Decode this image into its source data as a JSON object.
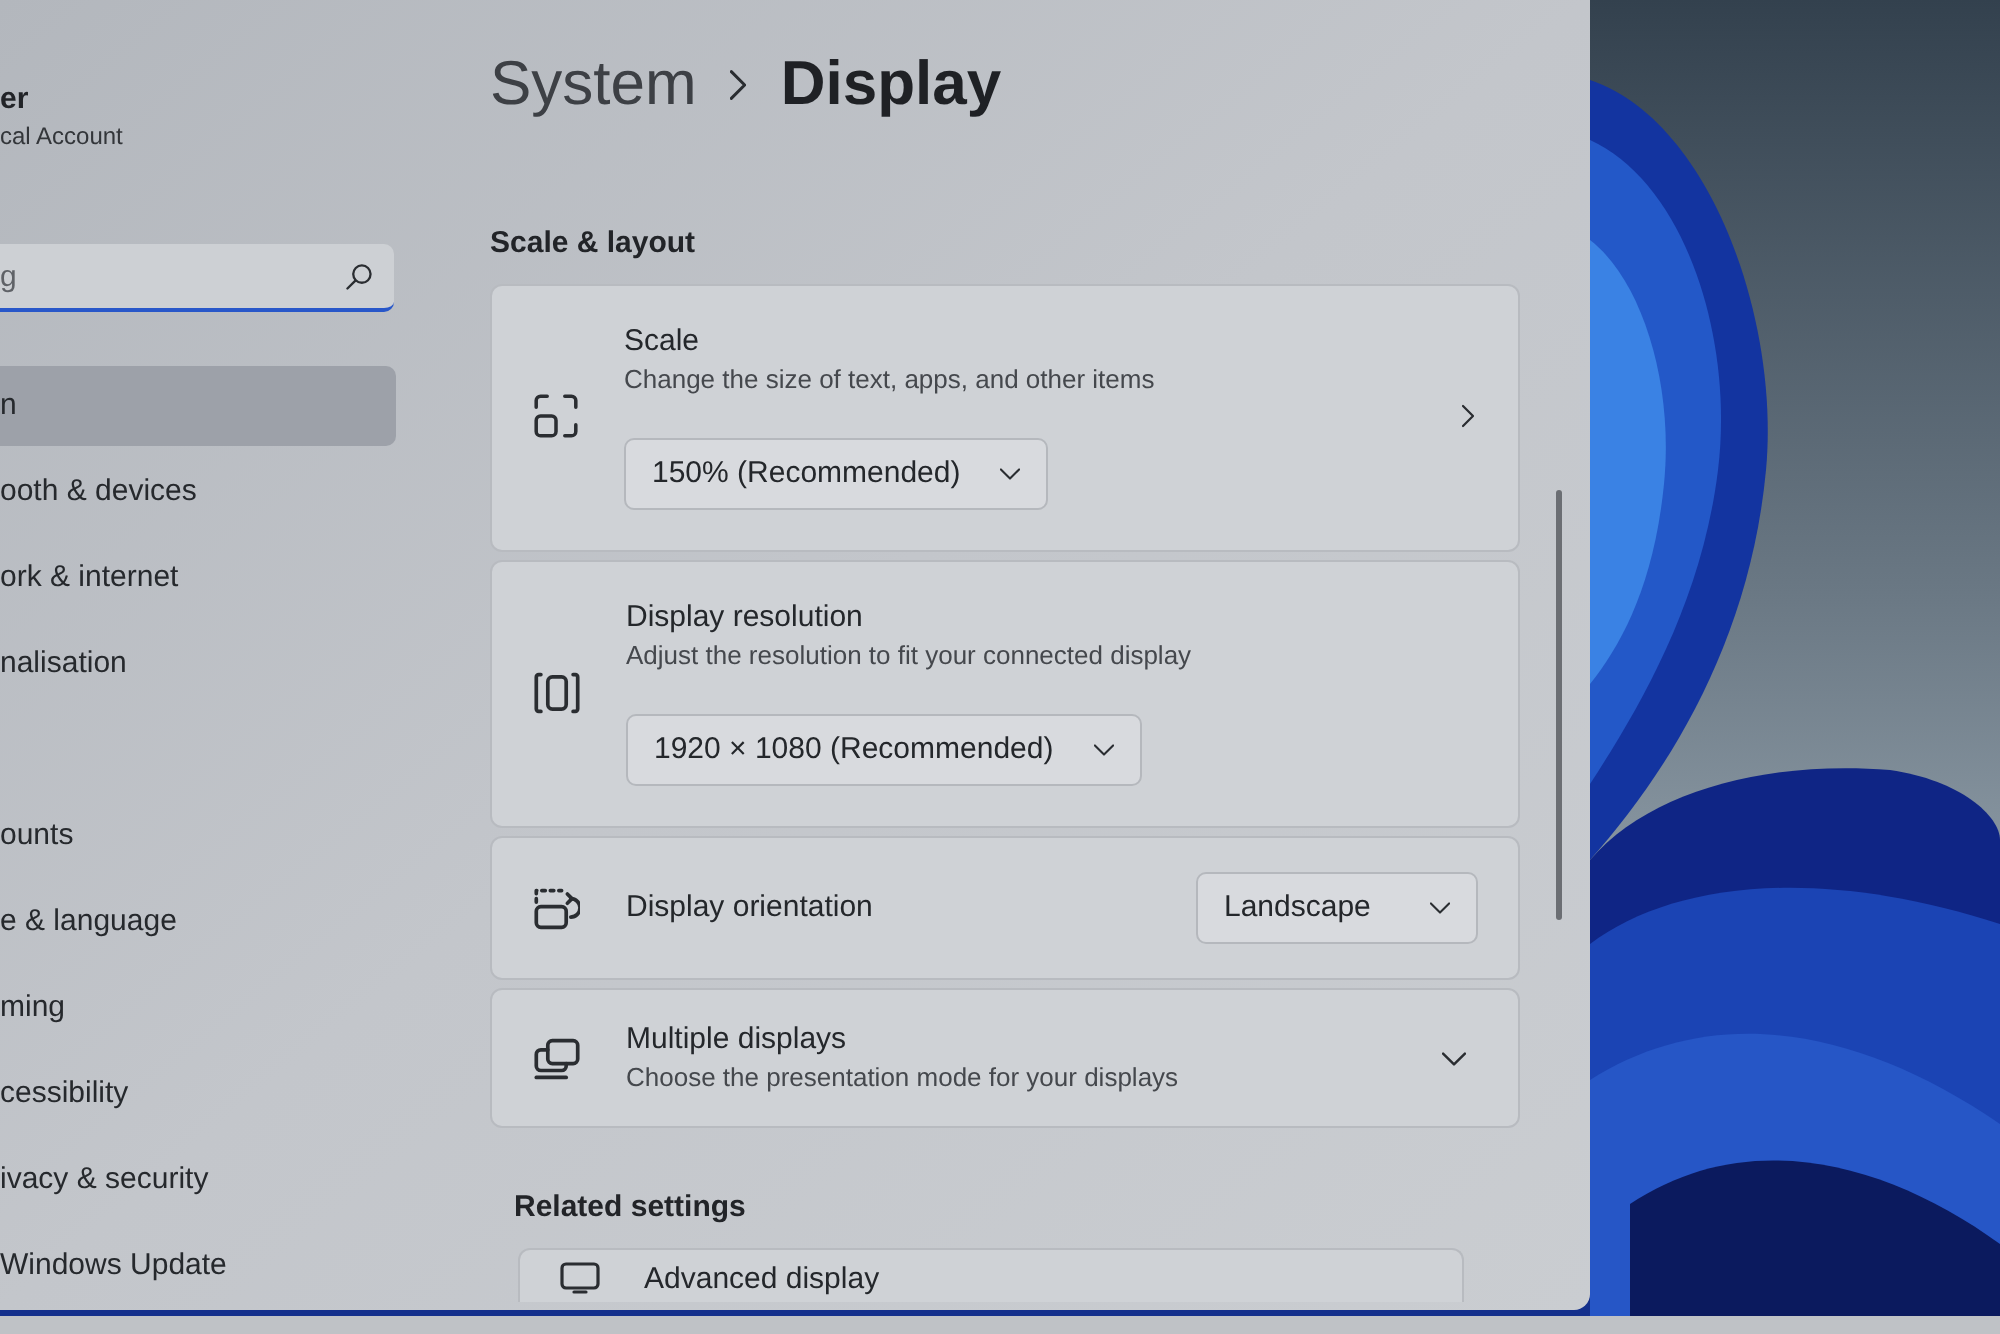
{
  "account": {
    "name": "er",
    "type": "cal Account"
  },
  "search": {
    "placeholder": "g"
  },
  "sidebar": {
    "items": [
      {
        "label": "n",
        "selected": true
      },
      {
        "label": "ooth & devices",
        "selected": false
      },
      {
        "label": "ork & internet",
        "selected": false
      },
      {
        "label": "nalisation",
        "selected": false
      },
      {
        "label": "ounts",
        "selected": false
      },
      {
        "label": "e & language",
        "selected": false
      },
      {
        "label": "ming",
        "selected": false
      },
      {
        "label": "cessibility",
        "selected": false
      },
      {
        "label": "ivacy & security",
        "selected": false
      },
      {
        "label": "Windows Update",
        "selected": false
      }
    ]
  },
  "breadcrumb": {
    "parent": "System",
    "current": "Display"
  },
  "section": {
    "title": "Scale & layout",
    "settings": [
      {
        "kind": "dropdown_nav",
        "title": "Scale",
        "description": "Change the size of text, apps, and other items",
        "value": "150% (Recommended)"
      },
      {
        "kind": "dropdown_below",
        "title": "Display resolution",
        "description": "Adjust the resolution to fit your connected display",
        "value": "1920 × 1080 (Recommended)"
      },
      {
        "kind": "inline_dropdown",
        "title": "Display orientation",
        "value": "Landscape"
      },
      {
        "kind": "expander",
        "title": "Multiple displays",
        "description": "Choose the presentation mode for your displays",
        "expanded": false
      }
    ]
  },
  "related": {
    "title": "Related settings",
    "items": [
      {
        "title": "Advanced display"
      }
    ]
  }
}
